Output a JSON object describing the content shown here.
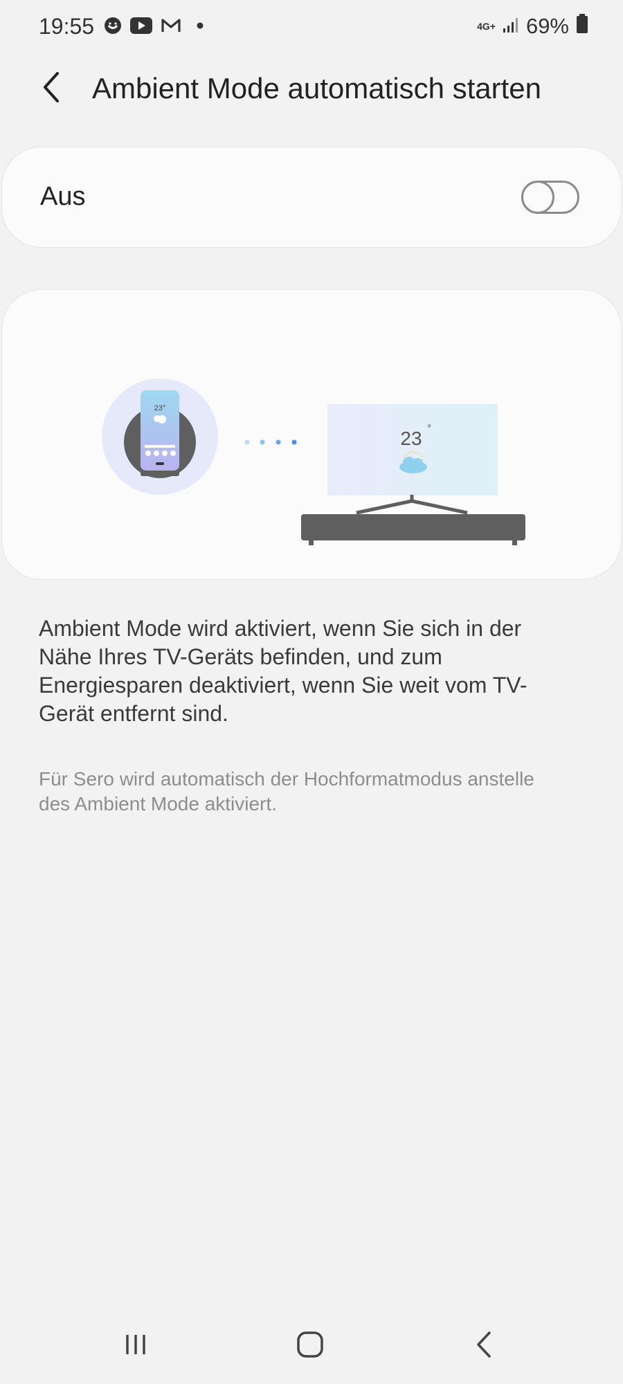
{
  "status_bar": {
    "time": "19:55",
    "network": "4G+",
    "battery": "69%",
    "left_icons": [
      "smiley-icon",
      "youtube-icon",
      "gmail-icon",
      "dot-icon"
    ]
  },
  "header": {
    "title": "Ambient Mode automatisch starten",
    "back_icon": "chevron-left-icon"
  },
  "toggle": {
    "label": "Aus",
    "state": false
  },
  "illustration": {
    "phone_temp": "23°",
    "tv_temp": "23",
    "tv_degree": "°"
  },
  "description": "Ambient Mode wird aktiviert, wenn Sie sich in der Nähe Ihres TV-Geräts befinden, und zum Energiesparen deaktiviert, wenn Sie weit vom TV-Gerät entfernt sind.",
  "note": "Für Sero wird automatisch der Hochformatmodus anstelle des Ambient Mode aktiviert.",
  "nav": {
    "recents_icon": "recents-icon",
    "home_icon": "home-icon",
    "back_icon": "back-icon"
  },
  "colors": {
    "background": "#f2f2f2",
    "card": "#fbfbfb",
    "accent_blue": "#4a90e2",
    "device_dark": "#5f5f5f"
  }
}
